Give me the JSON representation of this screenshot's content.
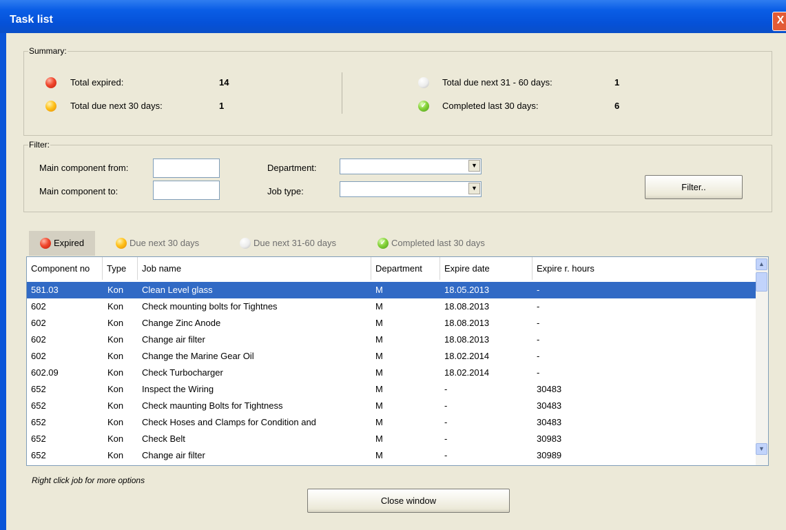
{
  "window": {
    "title": "Task list",
    "close_label": "X"
  },
  "summary": {
    "legend": "Summary:",
    "items": [
      {
        "label": "Total expired:",
        "value": "14",
        "color": "#e8432a"
      },
      {
        "label": "Total due next 30 days:",
        "value": "1",
        "color": "#ffb800"
      },
      {
        "label": "Total due next 31 - 60 days:",
        "value": "1",
        "color": "#e6e6e6"
      },
      {
        "label": "Completed last 30 days:",
        "value": "6",
        "color": "#7cc635"
      }
    ]
  },
  "filter": {
    "legend": "Filter:",
    "main_from_label": "Main component from:",
    "main_to_label": "Main component to:",
    "department_label": "Department:",
    "job_type_label": "Job type:",
    "main_from_value": "",
    "main_to_value": "",
    "department_value": "",
    "job_type_value": "",
    "filter_button": "Filter.."
  },
  "tabs": [
    {
      "label": "Expired",
      "active": true
    },
    {
      "label": "Due next 30 days",
      "active": false
    },
    {
      "label": "Due next 31-60 days",
      "active": false
    },
    {
      "label": "Completed last 30 days",
      "active": false
    }
  ],
  "table": {
    "columns": [
      "Component no",
      "Type",
      "Job name",
      "Department",
      "Expire date",
      "Expire r. hours"
    ],
    "rows": [
      [
        "581.03",
        "Kon",
        "Clean Level glass",
        "M",
        "18.05.2013",
        "-"
      ],
      [
        "602",
        "Kon",
        "Check mounting bolts for Tightnes",
        "M",
        "18.08.2013",
        "-"
      ],
      [
        "602",
        "Kon",
        "Change Zinc Anode",
        "M",
        "18.08.2013",
        "-"
      ],
      [
        "602",
        "Kon",
        "Change air filter",
        "M",
        "18.08.2013",
        "-"
      ],
      [
        "602",
        "Kon",
        "Change the Marine Gear Oil",
        "M",
        "18.02.2014",
        "-"
      ],
      [
        "602.09",
        "Kon",
        "Check Turbocharger",
        "M",
        "18.02.2014",
        "-"
      ],
      [
        "652",
        "Kon",
        "Inspect the Wiring",
        "M",
        "-",
        "30483"
      ],
      [
        "652",
        "Kon",
        "Check maunting Bolts for Tightness",
        "M",
        "-",
        "30483"
      ],
      [
        "652",
        "Kon",
        "Check Hoses and Clamps for Condition and",
        "M",
        "-",
        "30483"
      ],
      [
        "652",
        "Kon",
        "Check Belt",
        "M",
        "-",
        "30983"
      ],
      [
        "652",
        "Kon",
        "Change air filter",
        "M",
        "-",
        "30989"
      ]
    ],
    "selected_row": 0
  },
  "hint": "Right click job for more options",
  "close_button": "Close window"
}
